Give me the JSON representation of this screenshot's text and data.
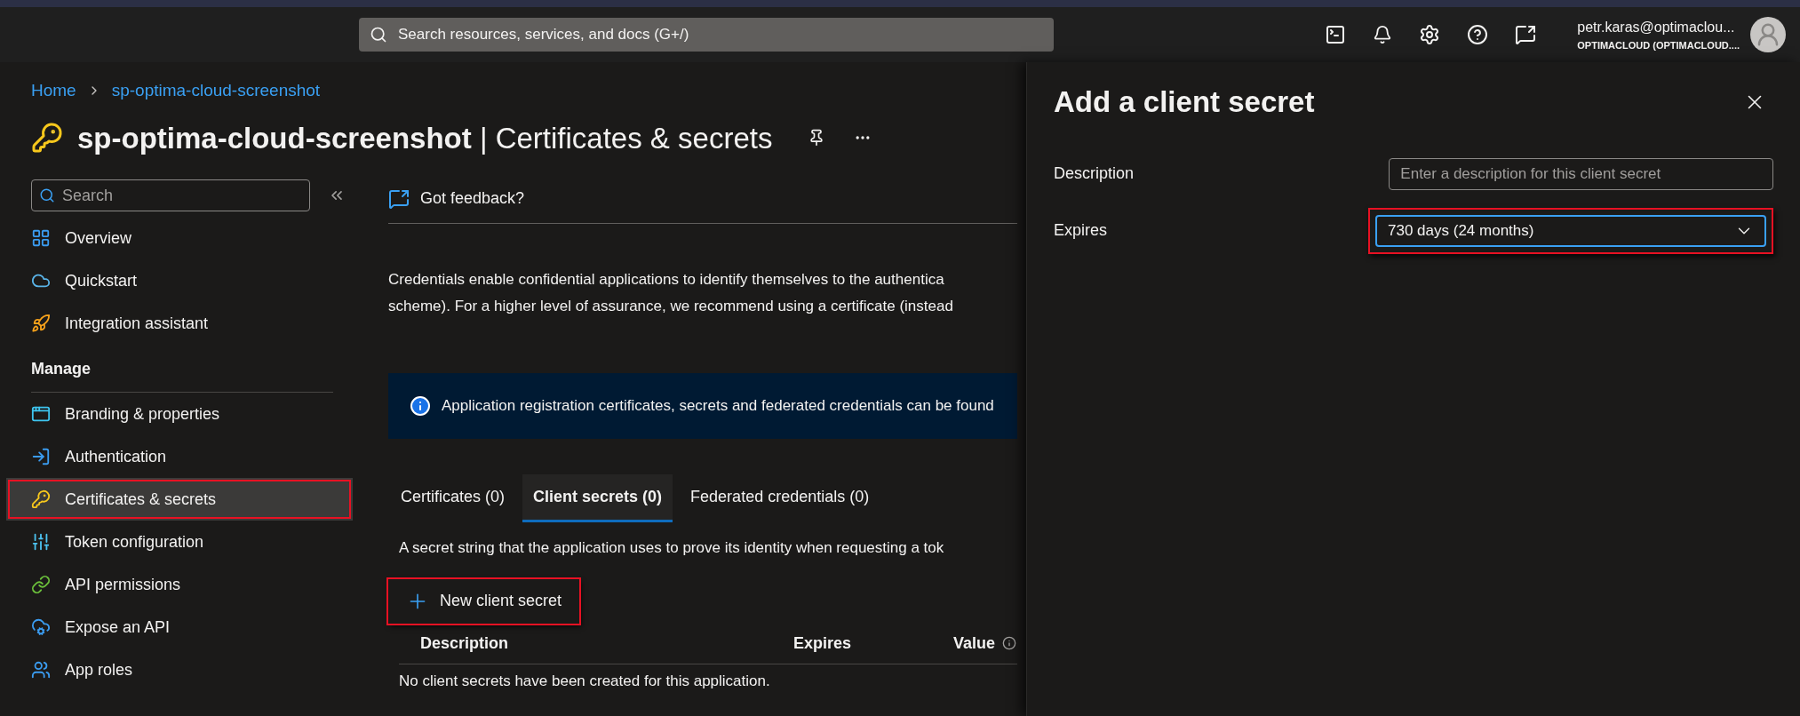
{
  "top_bar": {
    "search_placeholder": "Search resources, services, and docs (G+/)",
    "account": {
      "name": "petr.karas@optimaclou...",
      "directory": "OPTIMACLOUD (OPTIMACLOUD...."
    }
  },
  "breadcrumb": [
    "Home",
    "sp-optima-cloud-screenshot"
  ],
  "page_title": {
    "name": "sp-optima-cloud-screenshot",
    "separator": "|",
    "section": "Certificates & secrets"
  },
  "sidebar": {
    "search_placeholder": "Search",
    "items": [
      {
        "kind": "item",
        "label": "Overview",
        "selected": false,
        "highlighted": false
      },
      {
        "kind": "item",
        "label": "Quickstart",
        "selected": false,
        "highlighted": false
      },
      {
        "kind": "item",
        "label": "Integration assistant",
        "selected": false,
        "highlighted": false
      },
      {
        "kind": "heading",
        "label": "Manage"
      },
      {
        "kind": "item",
        "label": "Branding & properties",
        "selected": false,
        "highlighted": false
      },
      {
        "kind": "item",
        "label": "Authentication",
        "selected": false,
        "highlighted": false
      },
      {
        "kind": "item",
        "label": "Certificates & secrets",
        "selected": true,
        "highlighted": true
      },
      {
        "kind": "item",
        "label": "Token configuration",
        "selected": false,
        "highlighted": false
      },
      {
        "kind": "item",
        "label": "API permissions",
        "selected": false,
        "highlighted": false
      },
      {
        "kind": "item",
        "label": "Expose an API",
        "selected": false,
        "highlighted": false
      },
      {
        "kind": "item",
        "label": "App roles",
        "selected": false,
        "highlighted": false
      }
    ]
  },
  "main": {
    "feedback": "Got feedback?",
    "intro": [
      "Credentials enable confidential applications to identify themselves to the authentica",
      "scheme). For a higher level of assurance, we recommend using a certificate (instead"
    ],
    "info_banner": "Application registration certificates, secrets and federated credentials can be found",
    "tabs": [
      {
        "label": "Certificates (0)",
        "selected": false
      },
      {
        "label": "Client secrets (0)",
        "selected": true
      },
      {
        "label": "Federated credentials (0)",
        "selected": false
      }
    ],
    "tab_description": "A secret string that the application uses to prove its identity when requesting a tok",
    "new_button": {
      "label": "New client secret",
      "highlighted": true
    },
    "table": {
      "columns": [
        "Description",
        "Expires",
        "Value"
      ],
      "empty_message": "No client secrets have been created for this application."
    }
  },
  "panel": {
    "title": "Add a client secret",
    "fields": [
      {
        "kind": "text",
        "label": "Description",
        "placeholder": "Enter a description for this client secret"
      },
      {
        "kind": "select",
        "label": "Expires",
        "value": "730 days (24 months)",
        "highlighted": true
      }
    ]
  }
}
